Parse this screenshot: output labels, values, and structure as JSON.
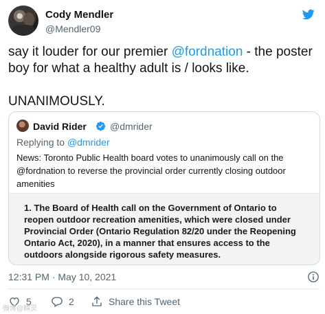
{
  "tweet": {
    "author_name": "Cody Mendler",
    "author_handle": "@Mendler09",
    "text_lines": [
      [
        "say it louder for our premier ",
        "@fordnation",
        " - the poster"
      ],
      "boy for what a healthy adult is / looks like.",
      "UNANIMOUSLY."
    ],
    "timestamp": "12:31 PM · May 10, 2021",
    "likes": "5",
    "replies": "2",
    "share_label": "Share this Tweet"
  },
  "quote": {
    "author_name": "David Rider",
    "author_handle": "@dmrider",
    "replying_prefix": "Replying to ",
    "replying_to": "@dmrider",
    "text_lines": [
      "News: Toronto Public Health board votes to unanimously  call on the",
      "@fordnation to reverse the provincial order currently closing outdoor",
      "amenities"
    ],
    "image_text_lines": [
      "1.  The Board of Health call on the Government of Ontario to",
      "reopen outdoor recreation amenities, which were closed under",
      "Provincial Order (Ontario Regulation 82/20 under the Reopening",
      "Ontario Act, 2020), in a manner that ensures access to the",
      "outdoors alongside rigorous safety measures."
    ]
  },
  "watermark": "微博@精灵",
  "colors": {
    "accent": "#1d9bf0",
    "secondary_text": "#536471",
    "border": "#cfd9de"
  }
}
